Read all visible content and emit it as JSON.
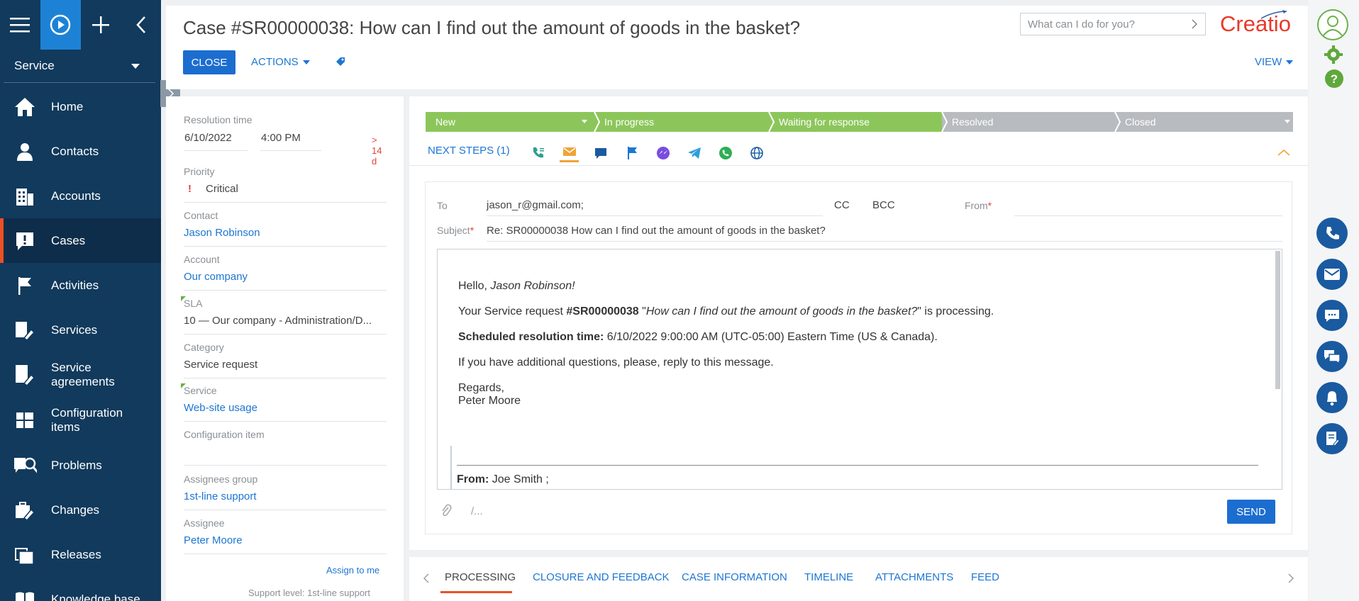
{
  "nav": {
    "workspace": "Service",
    "items": [
      {
        "label": "Home",
        "icon": "home-icon"
      },
      {
        "label": "Contacts",
        "icon": "person-icon"
      },
      {
        "label": "Accounts",
        "icon": "building-icon"
      },
      {
        "label": "Cases",
        "icon": "exclamation-icon"
      },
      {
        "label": "Activities",
        "icon": "flag-icon"
      },
      {
        "label": "Services",
        "icon": "tools-icon"
      },
      {
        "label": "Service agreements",
        "icon": "agreement-icon"
      },
      {
        "label": "Configuration items",
        "icon": "config-icon"
      },
      {
        "label": "Problems",
        "icon": "problem-icon"
      },
      {
        "label": "Changes",
        "icon": "change-icon"
      },
      {
        "label": "Releases",
        "icon": "release-icon"
      },
      {
        "label": "Knowledge base",
        "icon": "book-icon"
      }
    ]
  },
  "header": {
    "title": "Case #SR00000038: How can I find out the amount of goods in the basket?",
    "close_label": "CLOSE",
    "actions_label": "ACTIONS",
    "search_placeholder": "What can I do for you?",
    "logo": "Creatio",
    "view_label": "VIEW"
  },
  "details": {
    "resolution_time_label": "Resolution time",
    "resolution_date": "6/10/2022",
    "resolution_time": "4:00 PM",
    "overdue": "> 14 d",
    "priority_label": "Priority",
    "priority_mark": "!",
    "priority_value": "Critical",
    "contact_label": "Contact",
    "contact_value": "Jason Robinson",
    "account_label": "Account",
    "account_value": "Our company",
    "sla_label": "SLA",
    "sla_value": "10 — Our company - Administration/D...",
    "category_label": "Category",
    "category_value": "Service request",
    "service_label": "Service",
    "service_value": "Web-site usage",
    "config_item_label": "Configuration item",
    "config_item_value": "",
    "assignees_group_label": "Assignees group",
    "assignees_group_value": "1st-line support",
    "assignee_label": "Assignee",
    "assignee_value": "Peter Moore",
    "assign_to_me": "Assign to me",
    "support_level": "Support level: 1st-line support"
  },
  "stages": [
    {
      "label": "New",
      "color": "#8cc65b"
    },
    {
      "label": "In progress",
      "color": "#8cc65b"
    },
    {
      "label": "Waiting for response",
      "color": "#8cc65b"
    },
    {
      "label": "Resolved",
      "color": "#b8bcc0"
    },
    {
      "label": "Closed",
      "color": "#b8bcc0"
    }
  ],
  "next_steps_label": "NEXT STEPS (1)",
  "email": {
    "to_label": "To",
    "to_value": "jason_r@gmail.com;",
    "cc_label": "CC",
    "bcc_label": "BCC",
    "from_label": "From",
    "subject_label": "Subject",
    "subject_value": "Re: SR00000038 How can I find out the amount of goods in the basket?",
    "body": {
      "greeting": "Hello, ",
      "greeting_name": "Jason Robinson!",
      "line1_a": "Your Service request ",
      "line1_b": "#SR00000038",
      "line1_c": " \"",
      "line1_d": "How can I find out the amount of goods in the basket?",
      "line1_e": "\" is processing.",
      "line2_a": "Scheduled resolution time:",
      "line2_b": " 6/10/2022 9:00:00 AM (UTC-05:00) Eastern Time (US & Canada).",
      "line3": "If you have additional questions, please, reply to this message.",
      "regards": "Regards,",
      "signature": "Peter Moore",
      "from_quote_label": "From:",
      "from_quote_value": " Joe Smith ;"
    },
    "template_hint": "/...",
    "send_label": "SEND"
  },
  "tabs": [
    {
      "label": "PROCESSING"
    },
    {
      "label": "CLOSURE AND FEEDBACK"
    },
    {
      "label": "CASE INFORMATION"
    },
    {
      "label": "TIMELINE"
    },
    {
      "label": "ATTACHMENTS"
    },
    {
      "label": "FEED"
    }
  ]
}
